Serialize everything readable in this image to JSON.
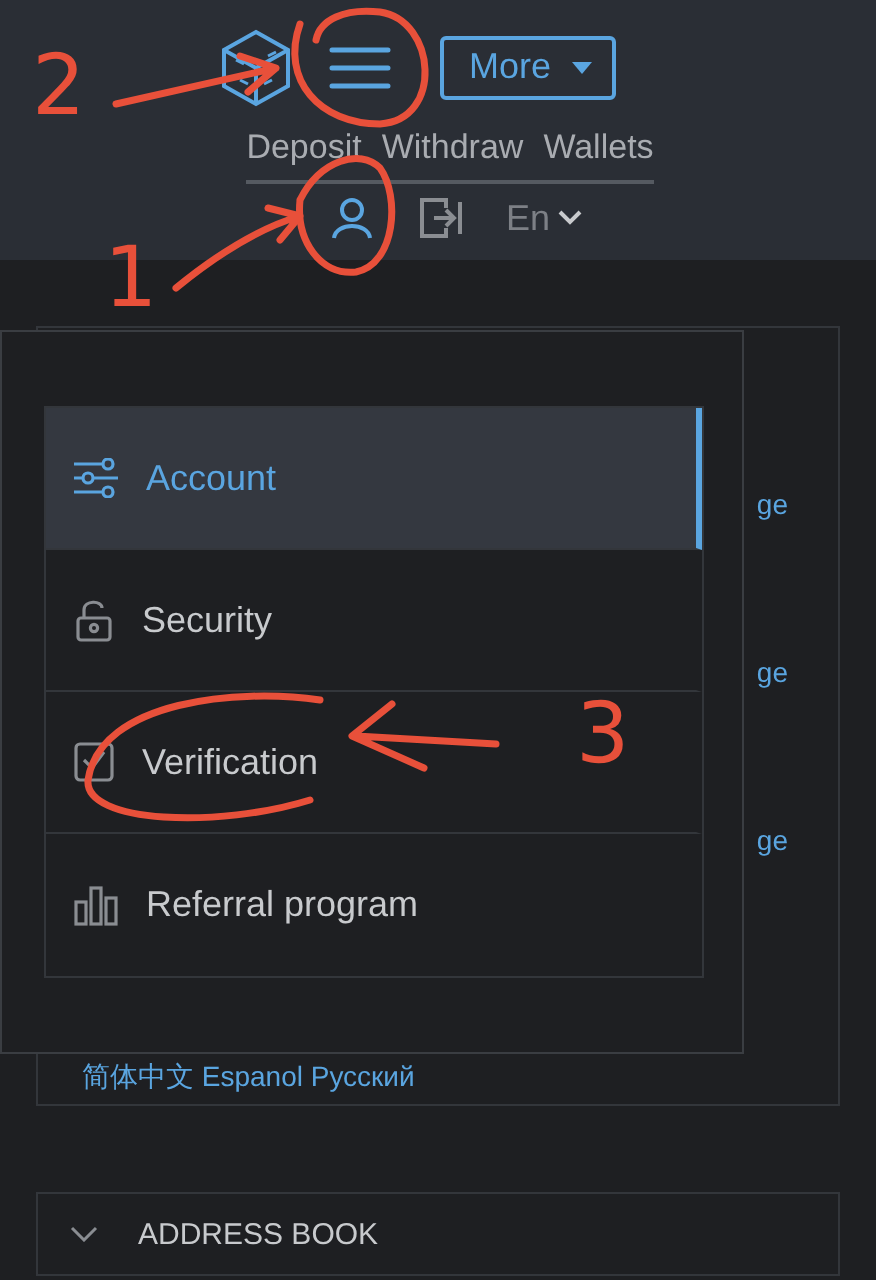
{
  "header": {
    "more_button": "More",
    "nav_links": [
      "Deposit",
      "Withdraw",
      "Wallets"
    ],
    "language": "En"
  },
  "background_card": {
    "links": [
      "ge",
      "ge",
      "ge"
    ],
    "languages": "简体中文 Espanol Русский"
  },
  "account_menu": {
    "items": [
      {
        "label": "Account",
        "kind": "sliders",
        "selected": true
      },
      {
        "label": "Security",
        "kind": "lock",
        "selected": false
      },
      {
        "label": "Verification",
        "kind": "check",
        "selected": false
      },
      {
        "label": "Referral program",
        "kind": "bars",
        "selected": false
      }
    ]
  },
  "sections": [
    {
      "title": "ADDRESS BOOK"
    }
  ],
  "annotations": [
    {
      "label": "2"
    },
    {
      "label": "1"
    },
    {
      "label": "3"
    }
  ]
}
